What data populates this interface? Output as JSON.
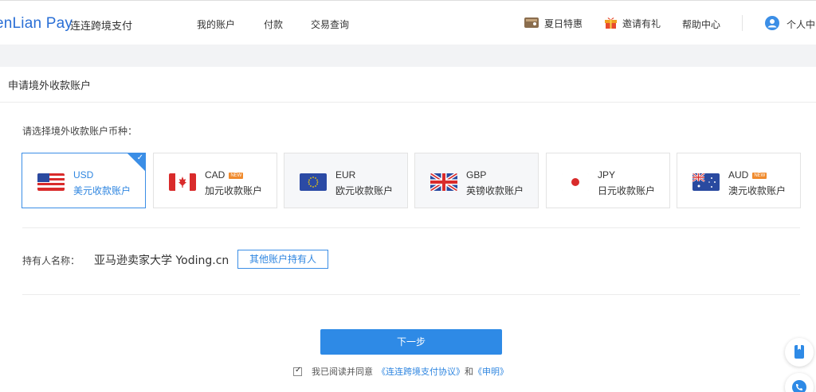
{
  "brand": {
    "logo_text": "enLian Pay",
    "logo_cn": "连连跨境支付",
    "color": "#2a6fd6"
  },
  "nav": {
    "links": [
      {
        "label": "我的账户"
      },
      {
        "label": "付款"
      },
      {
        "label": "交易查询"
      }
    ],
    "right": {
      "promo": "夏日特惠",
      "invite": "邀请有礼",
      "help": "帮助中心",
      "profile": "个人中"
    }
  },
  "page": {
    "title": "申请境外收款账户",
    "prompt": "请选择境外收款账户币种："
  },
  "currencies": [
    {
      "code": "USD",
      "name": "美元收款账户",
      "badge": "",
      "selected": true,
      "icon": "us-flag-icon"
    },
    {
      "code": "CAD",
      "name": "加元收款账户",
      "badge": "NEW",
      "selected": false,
      "icon": "canada-flag-icon"
    },
    {
      "code": "EUR",
      "name": "欧元收款账户",
      "badge": "",
      "selected": false,
      "icon": "eu-flag-icon"
    },
    {
      "code": "GBP",
      "name": "英镑收款账户",
      "badge": "",
      "selected": false,
      "icon": "uk-flag-icon"
    },
    {
      "code": "JPY",
      "name": "日元收款账户",
      "badge": "",
      "selected": false,
      "icon": "japan-flag-icon"
    },
    {
      "code": "AUD",
      "name": "澳元收款账户",
      "badge": "NEW",
      "selected": false,
      "icon": "australia-flag-icon"
    }
  ],
  "holder": {
    "label": "持有人名称：",
    "value": "亚马逊卖家大学 Yoding.cn",
    "other_button": "其他账户持有人"
  },
  "actions": {
    "next": "下一步",
    "agree_prefix": "我已阅读并同意",
    "agreement_link": "《连连跨境支付协议》",
    "and": "和",
    "statement_link": "《申明》"
  },
  "colors": {
    "accent": "#2e8ae6",
    "badge": "#f08a2c",
    "band": "#f2f3f5"
  }
}
